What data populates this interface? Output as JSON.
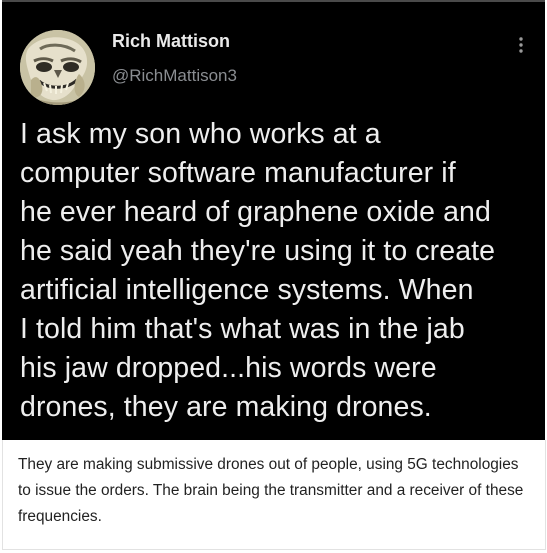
{
  "tweet": {
    "display_name": "Rich Mattison",
    "handle": "@RichMattison3",
    "text": "I ask my son who works at a\ncomputer software manufacturer if\nhe ever heard of graphene oxide and\nhe said yeah they're using it to create\nartificial intelligence systems.  When\nI told him that's what was in the jab\nhis jaw dropped...his words were\ndrones, they are making drones.",
    "avatar_icon": "skull-avatar-icon",
    "more_icon": "more-options-icon"
  },
  "caption": {
    "text": "They are making submissive drones out of people, using 5G technologies to issue the orders. The brain being the transmitter and a receiver of these frequencies."
  },
  "colors": {
    "tweet_background": "#000000",
    "name_text": "#eaeaea",
    "handle_text": "#8a8d91",
    "body_text": "#eeeeee",
    "caption_text": "#222222",
    "page_background": "#ffffff"
  }
}
